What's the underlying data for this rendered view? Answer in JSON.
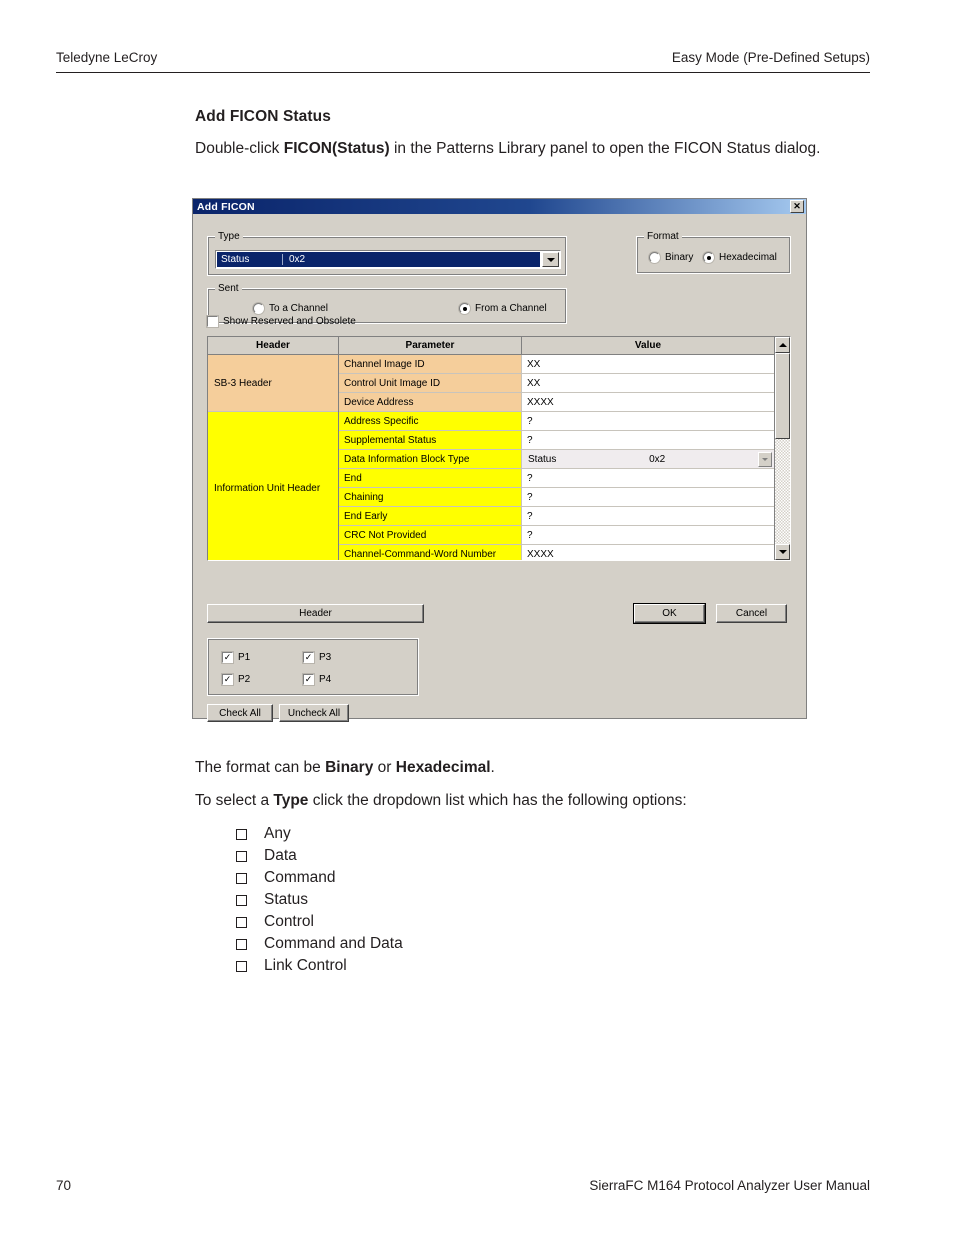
{
  "page": {
    "header_left": "Teledyne LeCroy",
    "header_right": "Easy Mode (Pre-Defined Setups)",
    "section_title": "Add FICON Status",
    "intro_prefix": "Double-click ",
    "intro_bold": "FICON(Status)",
    "intro_suffix": " in the Patterns Library panel to open the FICON Status dialog.",
    "format_prefix": "The format can be ",
    "format_bold1": "Binary",
    "format_mid": " or ",
    "format_bold2": "Hexadecimal",
    "format_suffix": ".",
    "select_prefix": "To select a ",
    "select_bold": "Type",
    "select_suffix": " click the dropdown list which has the following options:",
    "options": [
      "Any",
      "Data",
      "Command",
      "Status",
      "Control",
      "Command and Data",
      "Link Control"
    ],
    "footer_page": "70",
    "footer_title": "SierraFC M164 Protocol Analyzer User Manual"
  },
  "dialog": {
    "title": "Add FICON",
    "close_glyph": "✕",
    "type": {
      "legend": "Type",
      "selected_name": "Status",
      "selected_value": "0x2"
    },
    "sent": {
      "legend": "Sent",
      "to_a_channel": "To a Channel",
      "from_a_channel": "From a Channel",
      "selected": "From a Channel"
    },
    "format": {
      "legend": "Format",
      "binary": "Binary",
      "hexadecimal": "Hexadecimal",
      "selected": "Hexadecimal"
    },
    "show_reserved": {
      "label": "Show Reserved and Obsolete",
      "checked": false
    },
    "table": {
      "columns": [
        "Header",
        "Parameter",
        "Value"
      ],
      "groups": [
        {
          "name": "SB-3 Header",
          "color": "#f5ce9b",
          "rows": [
            {
              "parameter": "Channel Image ID",
              "value": "XX",
              "type": "text"
            },
            {
              "parameter": "Control Unit Image ID",
              "value": "XX",
              "type": "text"
            },
            {
              "parameter": "Device Address",
              "value": "XXXX",
              "type": "text"
            }
          ]
        },
        {
          "name": "Information Unit Header",
          "color": "#ffff00",
          "rows": [
            {
              "parameter": "Address Specific",
              "value": "?",
              "type": "text"
            },
            {
              "parameter": "Supplemental Status",
              "value": "?",
              "type": "text"
            },
            {
              "parameter": "Data Information Block Type",
              "value": "Status",
              "value2": "0x2",
              "type": "combo"
            },
            {
              "parameter": "End",
              "value": "?",
              "type": "text"
            },
            {
              "parameter": "Chaining",
              "value": "?",
              "type": "text"
            },
            {
              "parameter": "End Early",
              "value": "?",
              "type": "text"
            },
            {
              "parameter": "CRC Not Provided",
              "value": "?",
              "type": "text"
            },
            {
              "parameter": "Channel-Command-Word Number",
              "value": "XXXX",
              "type": "text"
            }
          ]
        }
      ]
    },
    "buttons": {
      "header": "Header",
      "ok": "OK",
      "cancel": "Cancel",
      "check_all": "Check All",
      "uncheck_all": "Uncheck All"
    },
    "ports": [
      {
        "label": "P1",
        "checked": true
      },
      {
        "label": "P2",
        "checked": true
      },
      {
        "label": "P3",
        "checked": true
      },
      {
        "label": "P4",
        "checked": true
      }
    ]
  }
}
